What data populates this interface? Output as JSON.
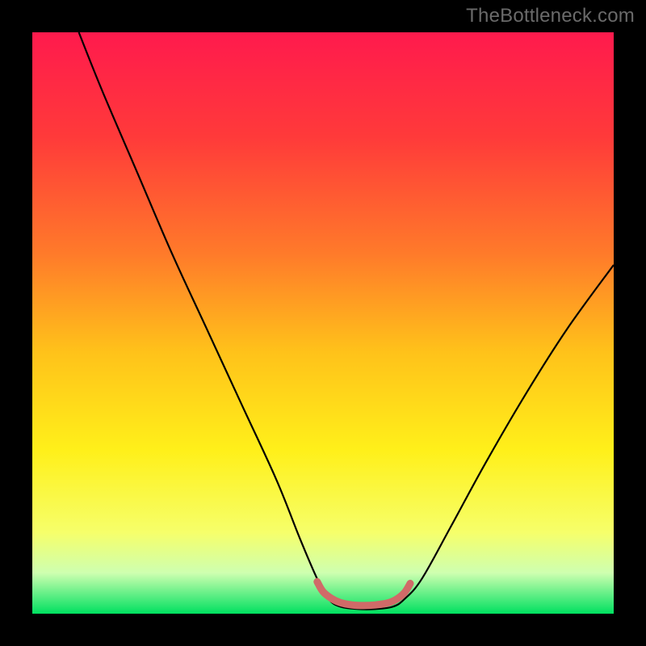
{
  "watermark": "TheBottleneck.com",
  "chart_data": {
    "type": "line",
    "title": "",
    "xlabel": "",
    "ylabel": "",
    "xlim": [
      0,
      100
    ],
    "ylim": [
      0,
      100
    ],
    "background_gradient_stops": [
      {
        "offset": 0,
        "color": "#ff1a4d"
      },
      {
        "offset": 18,
        "color": "#ff3a3a"
      },
      {
        "offset": 38,
        "color": "#ff7a2a"
      },
      {
        "offset": 55,
        "color": "#ffc21a"
      },
      {
        "offset": 72,
        "color": "#fff01a"
      },
      {
        "offset": 86,
        "color": "#f6ff6a"
      },
      {
        "offset": 93,
        "color": "#ceffb0"
      },
      {
        "offset": 100,
        "color": "#00e060"
      }
    ],
    "series": [
      {
        "name": "bottleneck-curve",
        "stroke": "#000000",
        "values": [
          {
            "x": 8,
            "y": 100
          },
          {
            "x": 12,
            "y": 90
          },
          {
            "x": 18,
            "y": 76
          },
          {
            "x": 24,
            "y": 62
          },
          {
            "x": 30,
            "y": 49
          },
          {
            "x": 36,
            "y": 36
          },
          {
            "x": 42,
            "y": 23
          },
          {
            "x": 46,
            "y": 13
          },
          {
            "x": 49,
            "y": 6
          },
          {
            "x": 51,
            "y": 2.5
          },
          {
            "x": 53,
            "y": 1.2
          },
          {
            "x": 56,
            "y": 0.8
          },
          {
            "x": 59,
            "y": 0.8
          },
          {
            "x": 62,
            "y": 1.2
          },
          {
            "x": 64,
            "y": 2.5
          },
          {
            "x": 67,
            "y": 6
          },
          {
            "x": 72,
            "y": 15
          },
          {
            "x": 78,
            "y": 26
          },
          {
            "x": 85,
            "y": 38
          },
          {
            "x": 92,
            "y": 49
          },
          {
            "x": 100,
            "y": 60
          }
        ]
      },
      {
        "name": "sweet-spot-marker",
        "stroke": "#d06a68",
        "stroke_width": 9,
        "values": [
          {
            "x": 49,
            "y": 5.5
          },
          {
            "x": 50,
            "y": 3.8
          },
          {
            "x": 51.5,
            "y": 2.6
          },
          {
            "x": 53,
            "y": 1.9
          },
          {
            "x": 55,
            "y": 1.5
          },
          {
            "x": 57,
            "y": 1.4
          },
          {
            "x": 59,
            "y": 1.5
          },
          {
            "x": 61,
            "y": 1.8
          },
          {
            "x": 62.5,
            "y": 2.4
          },
          {
            "x": 64,
            "y": 3.6
          },
          {
            "x": 65,
            "y": 5.2
          }
        ]
      }
    ]
  }
}
